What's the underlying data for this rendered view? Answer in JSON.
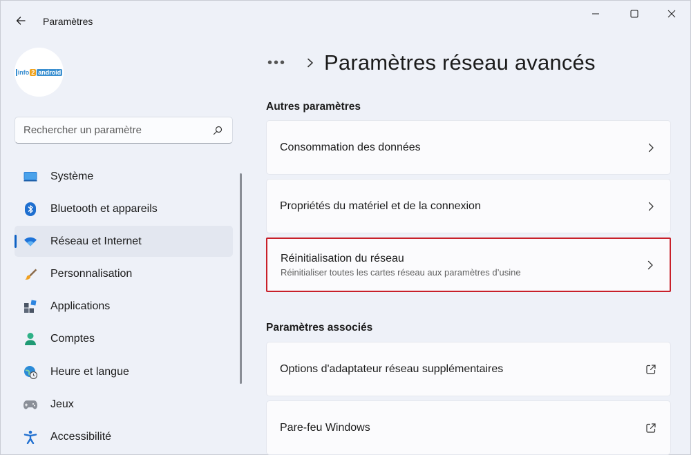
{
  "window": {
    "app_title": "Paramètres"
  },
  "sidebar": {
    "search_placeholder": "Rechercher un paramètre",
    "items": [
      {
        "label": "Système",
        "icon": "monitor-icon"
      },
      {
        "label": "Bluetooth et appareils",
        "icon": "bluetooth-icon"
      },
      {
        "label": "Réseau et Internet",
        "icon": "wifi-icon",
        "active": true
      },
      {
        "label": "Personnalisation",
        "icon": "paintbrush-icon"
      },
      {
        "label": "Applications",
        "icon": "apps-icon"
      },
      {
        "label": "Comptes",
        "icon": "person-icon"
      },
      {
        "label": "Heure et langue",
        "icon": "clock-globe-icon"
      },
      {
        "label": "Jeux",
        "icon": "gamepad-icon"
      },
      {
        "label": "Accessibilité",
        "icon": "accessibility-icon"
      }
    ]
  },
  "main": {
    "breadcrumb_more": "•••",
    "page_title": "Paramètres réseau avancés",
    "sections": [
      {
        "title": "Autres paramètres",
        "cards": [
          {
            "label": "Consommation des données",
            "action": "chevron"
          },
          {
            "label": "Propriétés du matériel et de la connexion",
            "action": "chevron"
          },
          {
            "label": "Réinitialisation du réseau",
            "sublabel": "Réinitialiser toutes les cartes réseau aux paramètres d’usine",
            "action": "chevron",
            "highlighted": true
          }
        ]
      },
      {
        "title": "Paramètres associés",
        "cards": [
          {
            "label": "Options d'adaptateur réseau supplémentaires",
            "action": "external-link"
          },
          {
            "label": "Pare-feu Windows",
            "action": "external-link"
          }
        ]
      }
    ]
  },
  "colors": {
    "accent": "#0f62c4",
    "highlight_border": "#c8202a",
    "background": "#eef1f8"
  }
}
